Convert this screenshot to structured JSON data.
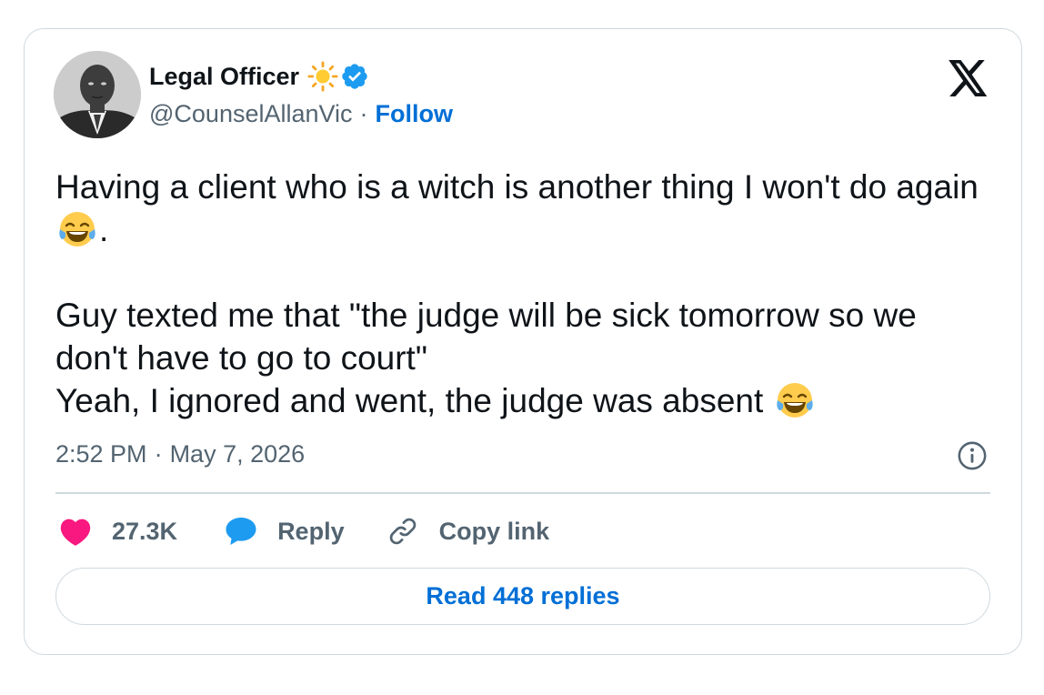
{
  "author": {
    "name": "Legal Officer",
    "handle": "@CounselAllanVic",
    "separator": "·",
    "follow_label": "Follow",
    "verified": true,
    "name_emoji_icon": "sun-icon",
    "avatar_icon": "avatar-photo"
  },
  "tweet": {
    "paragraphs": [
      "Having a client who is a witch is another thing I won't do again",
      "Guy texted me that \"the judge will be sick tomorrow so we don't have to go to court\"",
      "Yeah, I ignored and went, the judge was absent"
    ],
    "emoji_icon": "tears-of-joy-emoji-icon",
    "trailing_period": "."
  },
  "meta": {
    "time": "2:52 PM",
    "separator": "·",
    "date": "May 7, 2026"
  },
  "actions": {
    "likes_count": "27.3K",
    "reply_label": "Reply",
    "copy_link_label": "Copy link"
  },
  "read_replies_label": "Read 448 replies",
  "colors": {
    "like": "#f91880",
    "reply": "#1d9bf0",
    "link": "#006fd6",
    "border": "#cfd9de",
    "muted": "#536471",
    "text": "#0f1419"
  }
}
